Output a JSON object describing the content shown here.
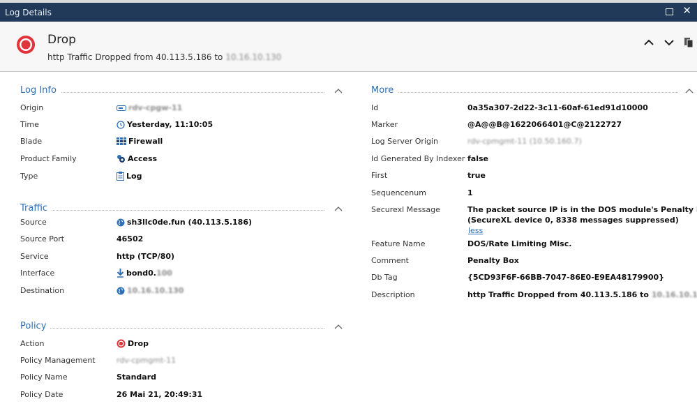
{
  "window": {
    "title": "Log Details"
  },
  "header": {
    "title": "Drop",
    "subtitle": "http Traffic Dropped from 40.113.5.186 to",
    "subtitle_dest": "10.16.10.130"
  },
  "log_info": {
    "title": "Log Info",
    "rows": [
      {
        "label": "Origin",
        "value": "rdv-cpgw-11"
      },
      {
        "label": "Time",
        "value": "Yesterday, 11:10:05"
      },
      {
        "label": "Blade",
        "value": "Firewall"
      },
      {
        "label": "Product Family",
        "value": "Access"
      },
      {
        "label": "Type",
        "value": "Log"
      }
    ]
  },
  "traffic": {
    "title": "Traffic",
    "rows": [
      {
        "label": "Source",
        "value": "sh3llc0de.fun (40.113.5.186)"
      },
      {
        "label": "Source Port",
        "value": "46502"
      },
      {
        "label": "Service",
        "value": "http (TCP/80)"
      },
      {
        "label": "Interface",
        "value": "bond0.",
        "value_blur": "100"
      },
      {
        "label": "Destination",
        "value": "10.16.10.130"
      }
    ]
  },
  "policy": {
    "title": "Policy",
    "rows": [
      {
        "label": "Action",
        "value": "Drop"
      },
      {
        "label": "Policy Management",
        "value": "rdv-cpmgmt-11"
      },
      {
        "label": "Policy Name",
        "value": "Standard"
      },
      {
        "label": "Policy Date",
        "value": "26 Mai 21, 20:49:31"
      }
    ]
  },
  "more": {
    "title": "More",
    "rows": [
      {
        "label": "Id",
        "value": "0a35a307-2d22-3c11-60af-61ed91d10000"
      },
      {
        "label": "Marker",
        "value": "@A@@B@1622066401@C@2122727"
      },
      {
        "label": "Log Server Origin",
        "value": "rdv-cpmgmt-11 (10.50.160.7)"
      },
      {
        "label": "Id Generated By Indexer",
        "value": "false"
      },
      {
        "label": "First",
        "value": "true"
      },
      {
        "label": "Sequencenum",
        "value": "1"
      },
      {
        "label": "Securexl Message",
        "value": "The packet source IP is in the DOS module's Penalty Box",
        "value_line2": "(SecureXL device 0, 8338 messages suppressed)",
        "link": "less"
      },
      {
        "label": "Feature Name",
        "value": "DOS/Rate Limiting Misc."
      },
      {
        "label": "Comment",
        "value": "Penalty Box"
      },
      {
        "label": "Db Tag",
        "value": "{5CD93F6F-66BB-7047-86E0-E9EA48179900}"
      },
      {
        "label": "Description",
        "value": "http Traffic Dropped from 40.113.5.186 to",
        "value_blur": "10.16.10.1...",
        "value_tail": "..."
      }
    ]
  },
  "icons": {
    "drop": "drop-icon",
    "gateway": "gateway-icon",
    "clock": "clock-icon",
    "firewall": "firewall-icon",
    "access": "access-icon",
    "log": "clipboard-icon",
    "globe": "globe-icon",
    "interface": "download-arrow-icon"
  },
  "colors": {
    "accent": "#2f6fb6",
    "drop": "#e0333a",
    "titlebar": "#223a5a"
  }
}
